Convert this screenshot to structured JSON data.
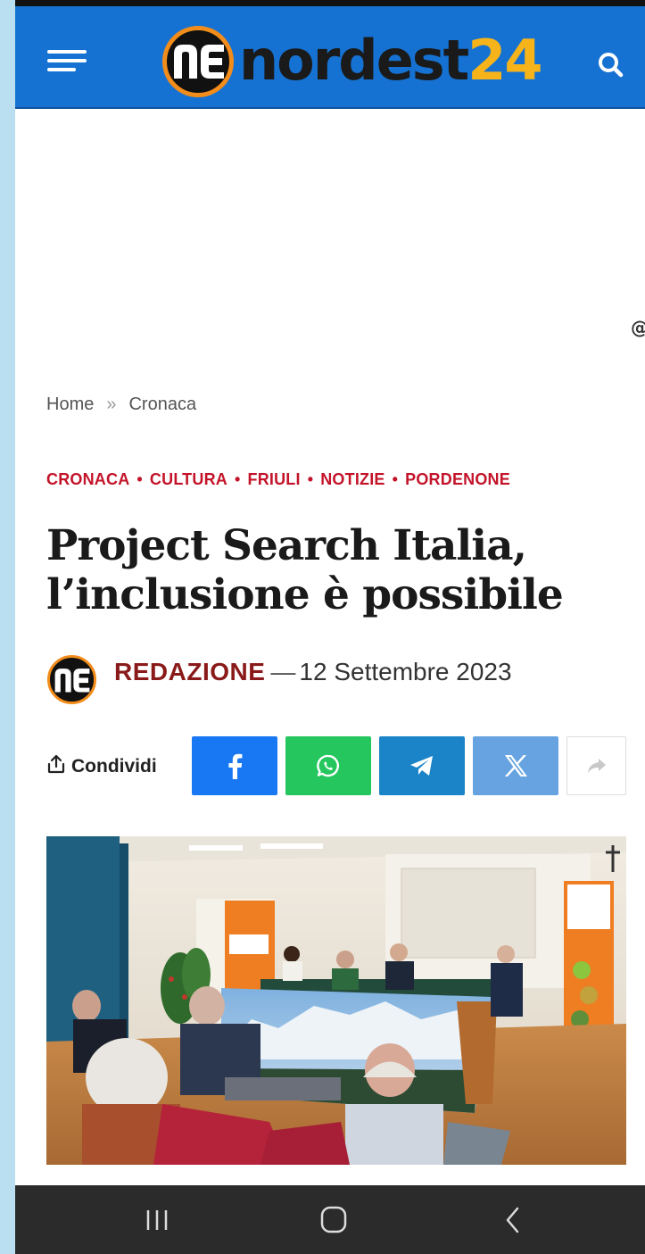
{
  "header": {
    "logo_word": "nordest",
    "logo_num": "24",
    "colors": {
      "bar": "#1672d2",
      "accent_orange": "#f28c1a",
      "logo_number": "#f6b31a"
    },
    "icons": {
      "menu": "hamburger-icon",
      "search": "search-icon"
    }
  },
  "breadcrumb": {
    "home": "Home",
    "separator": "»",
    "current": "Cronaca"
  },
  "categories": [
    "CRONACA",
    "CULTURA",
    "FRIULI",
    "NOTIZIE",
    "PORDENONE"
  ],
  "category_separator": "•",
  "article": {
    "title": "Project Search Italia, l’inclusione è possibile",
    "author": "REDAZIONE",
    "date_sep": "—",
    "date": "12 Settembre 2023"
  },
  "share": {
    "label": "Condividi",
    "buttons": [
      {
        "network": "facebook",
        "icon": "facebook-icon",
        "color": "#1877f2"
      },
      {
        "network": "whatsapp",
        "icon": "whatsapp-icon",
        "color": "#25c65e"
      },
      {
        "network": "telegram",
        "icon": "telegram-icon",
        "color": "#1b83c7"
      },
      {
        "network": "x",
        "icon": "x-icon",
        "color": "#66a3e0"
      },
      {
        "network": "more",
        "icon": "share-forward-icon",
        "color": "#ffffff"
      }
    ]
  },
  "navbar": {
    "icons": [
      "recent-apps-icon",
      "home-icon",
      "back-icon"
    ]
  }
}
